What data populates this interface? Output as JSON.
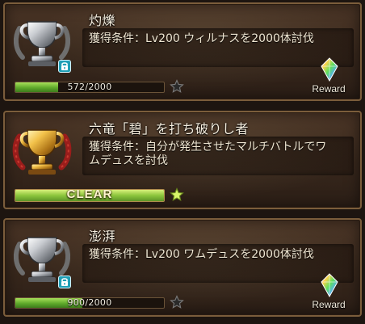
{
  "achievements": [
    {
      "title": "灼爍",
      "condition": "獲得条件：Lv200 ウィルナスを2000体討伐",
      "trophy": "silver-trophy-icon",
      "locked": true,
      "progress": {
        "current": 572,
        "total": 2000,
        "text": "572/2000"
      },
      "star": "dark",
      "reward": {
        "label": "Reward",
        "icon": "rainbow-crystal-icon"
      }
    },
    {
      "title": "六竜「碧」を打ち破りし者",
      "condition": "獲得条件：自分が発生させたマルチバトルでワムデュスを討伐",
      "trophy": "gold-trophy-icon",
      "locked": false,
      "progress": {
        "current": 1,
        "total": 1,
        "text": "CLEAR"
      },
      "star": "gold",
      "reward": null
    },
    {
      "title": "澎湃",
      "condition": "獲得条件：Lv200 ワムデュスを2000体討伐",
      "trophy": "silver-trophy-icon",
      "locked": true,
      "progress": {
        "current": 900,
        "total": 2000,
        "text": "900/2000"
      },
      "star": "dark",
      "reward": {
        "label": "Reward",
        "icon": "rainbow-crystal-icon"
      }
    }
  ]
}
